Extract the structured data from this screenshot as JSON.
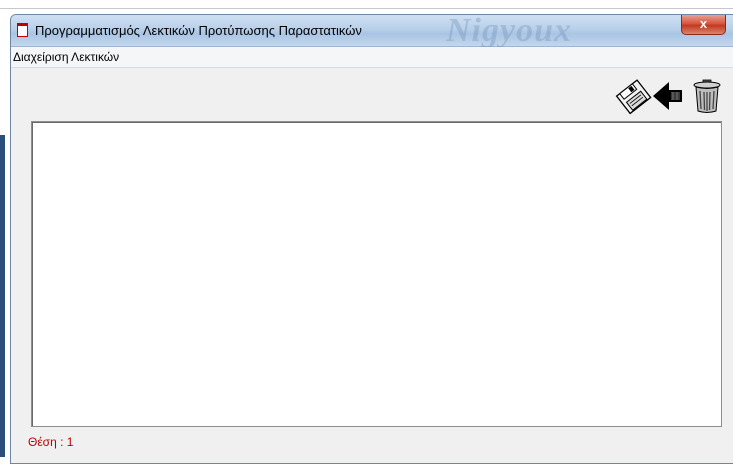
{
  "window": {
    "title": "Προγραμματισμός Λεκτικών Προτύπωσης Παραστατικών",
    "close_glyph": "x"
  },
  "menu": {
    "items": [
      {
        "label": "Διαχείριση Λεκτικών"
      }
    ]
  },
  "toolbar": {
    "buttons": [
      {
        "icon": "floppy-disk-icon"
      },
      {
        "icon": "back-arrow-icon"
      },
      {
        "icon": "trash-can-icon"
      }
    ]
  },
  "status": {
    "text": "Θέση : 1"
  },
  "colors": {
    "status_text": "#c00000",
    "title_bar": "#b9d0ea",
    "close_button": "#c23a1f"
  }
}
